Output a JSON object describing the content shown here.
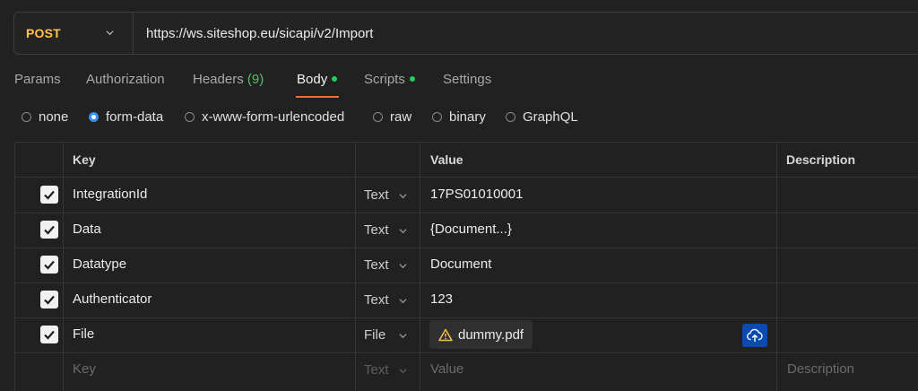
{
  "request": {
    "method": "POST",
    "url": "https://ws.siteshop.eu/sicapi/v2/Import"
  },
  "tabs": [
    {
      "label": "Params"
    },
    {
      "label": "Authorization"
    },
    {
      "label": "Headers",
      "count": "(9)"
    },
    {
      "label": "Body",
      "active": true,
      "dot": true
    },
    {
      "label": "Scripts",
      "dot": true
    },
    {
      "label": "Settings"
    }
  ],
  "body_modes": [
    {
      "label": "none"
    },
    {
      "label": "form-data",
      "selected": true
    },
    {
      "label": "x-www-form-urlencoded"
    },
    {
      "label": "raw"
    },
    {
      "label": "binary"
    },
    {
      "label": "GraphQL"
    }
  ],
  "table": {
    "headers": {
      "key": "Key",
      "value": "Value",
      "description": "Description"
    },
    "rows": [
      {
        "key": "IntegrationId",
        "type": "Text",
        "value": "17PS01010001"
      },
      {
        "key": "Data",
        "type": "Text",
        "value": "{Document...}"
      },
      {
        "key": "Datatype",
        "type": "Text",
        "value": "Document"
      },
      {
        "key": "Authenticator",
        "type": "Text",
        "value": "123"
      },
      {
        "key": "File",
        "type": "File",
        "value": "dummy.pdf"
      }
    ],
    "placeholder": {
      "key": "Key",
      "type": "Text",
      "value": "Value",
      "description": "Description"
    }
  },
  "colors": {
    "method": "#ffc24b",
    "active_tab_underline": "#e96e3a",
    "dot": "#1bd05a",
    "radio_selected": "#3a8ef0",
    "upload_button": "#0b4baf"
  }
}
